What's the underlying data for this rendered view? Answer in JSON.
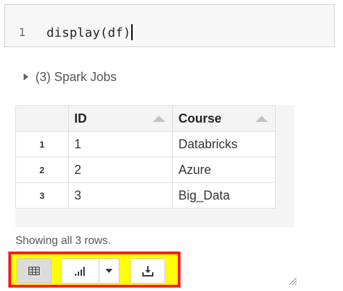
{
  "code_cell": {
    "line_number": "1",
    "code": "display(df)"
  },
  "spark_jobs": {
    "label": "(3) Spark Jobs"
  },
  "table": {
    "columns": [
      "ID",
      "Course"
    ],
    "rows": [
      {
        "index": "1",
        "id": "1",
        "course": "Databricks"
      },
      {
        "index": "2",
        "id": "2",
        "course": "Azure"
      },
      {
        "index": "3",
        "id": "3",
        "course": "Big_Data"
      }
    ]
  },
  "status": {
    "row_count_text": "Showing all 3 rows."
  },
  "toolbar": {
    "table_button": {
      "icon": "table-icon",
      "active": true
    },
    "chart_button": {
      "icon": "bar-chart-icon"
    },
    "chart_dropdown": {
      "icon": "chevron-down-icon"
    },
    "download_button": {
      "icon": "download-icon"
    },
    "highlight_fill": "#ffff00",
    "highlight_border": "#ff1a1a"
  }
}
